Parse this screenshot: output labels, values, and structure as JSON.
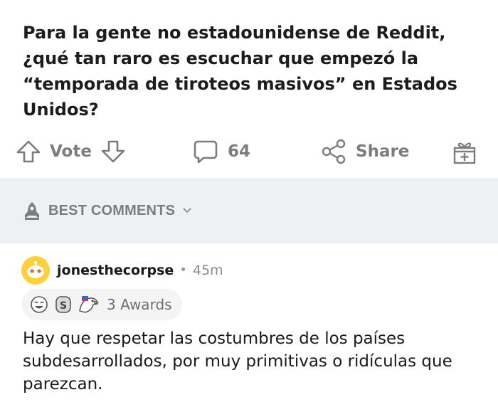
{
  "post": {
    "title": "Para la gente no estadounidense de Reddit, ¿qué tan raro es escuchar que empezó la “temporada de tiroteos masivos” en Estados Unidos?"
  },
  "actions": {
    "vote_label": "Vote",
    "comments_count": "64",
    "share_label": "Share"
  },
  "sort": {
    "label": "BEST COMMENTS"
  },
  "comment": {
    "username": "jonesthecorpse",
    "separator": "•",
    "time": "45m",
    "awards_label": "3 Awards",
    "body": "Hay que respetar las costumbres de los países subdesarrollados, por muy primitivas o ridículas que parezcan."
  },
  "colors": {
    "muted": "#7c7c7c",
    "band": "#edf1f3",
    "avatar": "#ffd03a"
  },
  "icons": {
    "upvote": "arrow-up-icon",
    "downvote": "arrow-down-icon",
    "comment": "speech-bubble-icon",
    "share": "share-nodes-icon",
    "award": "gift-icon",
    "sort": "rocket-icon",
    "chevron": "chevron-down-icon"
  }
}
